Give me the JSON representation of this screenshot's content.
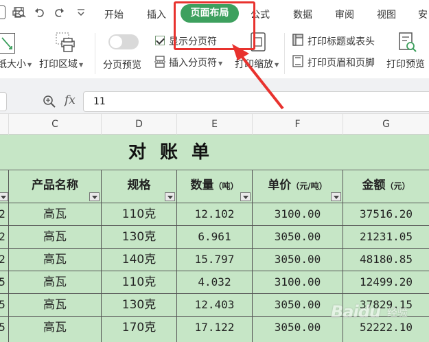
{
  "menu": {
    "tabs": [
      "开始",
      "插入",
      "页面布局",
      "公式",
      "数据",
      "审阅",
      "视图",
      "安"
    ],
    "active_tab": "页面布局"
  },
  "ribbon": {
    "paper_size": "纸大小",
    "print_area": "打印区域",
    "page_preview": "分页预览",
    "show_page_breaks": "显示分页符",
    "insert_page_break": "插入分页符",
    "print_zoom": "打印缩放",
    "print_titles": "打印标题或表头",
    "print_header_footer": "打印页眉和页脚",
    "print_preview": "打印预览"
  },
  "formula_bar": {
    "fx": "fx",
    "value": "11"
  },
  "columns": [
    "C",
    "D",
    "E",
    "F",
    "G"
  ],
  "sheet": {
    "title": "对账单",
    "headers": [
      {
        "label": "产品名称",
        "unit": ""
      },
      {
        "label": "规格",
        "unit": ""
      },
      {
        "label": "数量",
        "unit": "（吨）"
      },
      {
        "label": "单价",
        "unit": "（元/吨）"
      },
      {
        "label": "金额",
        "unit": "（元）"
      }
    ],
    "rows": [
      {
        "b": "2",
        "name": "高瓦",
        "spec": "110克",
        "qty": "12.102",
        "price": "3100.00",
        "amount": "37516.20"
      },
      {
        "b": "2",
        "name": "高瓦",
        "spec": "130克",
        "qty": "6.961",
        "price": "3050.00",
        "amount": "21231.05"
      },
      {
        "b": "2",
        "name": "高瓦",
        "spec": "140克",
        "qty": "15.797",
        "price": "3050.00",
        "amount": "48180.85"
      },
      {
        "b": "5",
        "name": "高瓦",
        "spec": "110克",
        "qty": "4.032",
        "price": "3100.00",
        "amount": "12499.20"
      },
      {
        "b": "5",
        "name": "高瓦",
        "spec": "130克",
        "qty": "12.403",
        "price": "3050.00",
        "amount": "37829.15"
      },
      {
        "b": "5",
        "name": "高瓦",
        "spec": "170克",
        "qty": "17.122",
        "price": "3050.00",
        "amount": "52222.10"
      }
    ]
  },
  "watermark": {
    "brand": "Baidu",
    "sub": "经验"
  },
  "colors": {
    "accent": "#3da05e",
    "sheet_fill": "#c6e6c6",
    "annotation": "#e8322e"
  }
}
